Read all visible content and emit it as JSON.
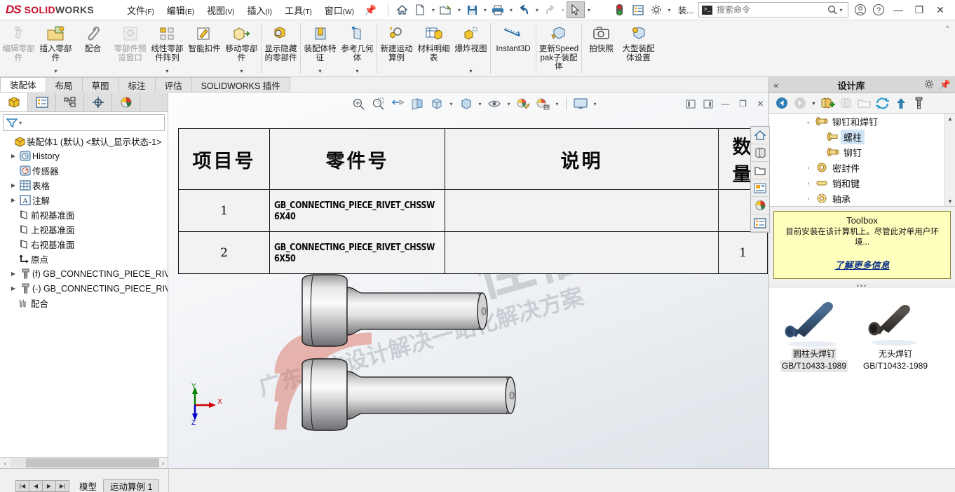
{
  "app": {
    "brand_ds": "DS",
    "brand_solid": "SOLID",
    "brand_works": "WORKS",
    "brand_color": "#c8102e"
  },
  "menubar": {
    "items": [
      {
        "label": "文件",
        "mnemonic": "(F)"
      },
      {
        "label": "编辑",
        "mnemonic": "(E)"
      },
      {
        "label": "视图",
        "mnemonic": "(V)"
      },
      {
        "label": "插入",
        "mnemonic": "(I)"
      },
      {
        "label": "工具",
        "mnemonic": "(T)"
      },
      {
        "label": "窗口",
        "mnemonic": "(W)"
      }
    ],
    "pin": "pin-icon"
  },
  "quick_access": {
    "buttons": [
      {
        "name": "home-button",
        "icon": "home-icon",
        "caret": false
      },
      {
        "name": "new-document-button",
        "icon": "new-file-icon",
        "caret": true
      },
      {
        "name": "open-document-button",
        "icon": "open-folder-icon",
        "caret": true
      },
      {
        "name": "save-button",
        "icon": "save-floppy-icon",
        "caret": true
      },
      {
        "name": "print-button",
        "icon": "printer-icon",
        "caret": true
      },
      {
        "name": "undo-button",
        "icon": "undo-arrow-icon",
        "caret": true
      },
      {
        "name": "redo-button",
        "icon": "redo-arrow-icon",
        "caret": true
      },
      {
        "name": "select-button",
        "icon": "cursor-arrow-icon",
        "caret": true
      }
    ]
  },
  "title_right": {
    "rebuild_icon": "traffic-light-icon",
    "display_icon": "display-pane-icon",
    "options_icon": "gear-icon",
    "config_label": "装...",
    "search_placeholder": "搜索命令",
    "search_value": "",
    "search_icon": "magnifier-icon",
    "command_icon": "command-prompt-icon",
    "account_icon": "user-account-icon",
    "help_icon": "question-help-icon",
    "minimize": "—",
    "restore": "❐",
    "close": "✕"
  },
  "ribbon": {
    "collapse_icon": "chevron-up-icon",
    "buttons": [
      {
        "label": "编辑零部件",
        "icon": "edit-component-icon",
        "dropdown": false,
        "disabled": true,
        "group": 0
      },
      {
        "label": "插入零部件",
        "icon": "insert-component-icon",
        "dropdown": true,
        "disabled": false,
        "group": 0
      },
      {
        "label": "配合",
        "icon": "mate-paperclip-icon",
        "dropdown": false,
        "disabled": false,
        "group": 0
      },
      {
        "label": "零部件预览窗口",
        "icon": "component-preview-icon",
        "dropdown": false,
        "disabled": true,
        "group": 0
      },
      {
        "label": "线性零部件阵列",
        "icon": "linear-component-pattern-icon",
        "dropdown": true,
        "disabled": false,
        "group": 0
      },
      {
        "label": "智能扣件",
        "icon": "smart-fastener-icon",
        "dropdown": false,
        "disabled": false,
        "group": 0
      },
      {
        "label": "移动零部件",
        "icon": "move-component-icon",
        "dropdown": true,
        "disabled": false,
        "group": 0
      },
      {
        "label": "显示隐藏的零部件",
        "icon": "show-hidden-components-icon",
        "dropdown": false,
        "disabled": false,
        "group": 1
      },
      {
        "label": "装配体特征",
        "icon": "assembly-feature-icon",
        "dropdown": true,
        "disabled": false,
        "group": 2
      },
      {
        "label": "参考几何体",
        "icon": "reference-geometry-icon",
        "dropdown": true,
        "disabled": false,
        "group": 2
      },
      {
        "label": "新建运动算例",
        "icon": "new-motion-study-icon",
        "dropdown": false,
        "disabled": false,
        "group": 3
      },
      {
        "label": "材料明细表",
        "icon": "bill-of-materials-icon",
        "dropdown": false,
        "disabled": false,
        "group": 3
      },
      {
        "label": "爆炸视图",
        "icon": "exploded-view-icon",
        "dropdown": true,
        "disabled": false,
        "group": 3
      },
      {
        "label": "Instant3D",
        "icon": "instant3d-icon",
        "dropdown": false,
        "disabled": false,
        "group": 4
      },
      {
        "label": "更新Speedpak子装配体",
        "icon": "update-speedpak-icon",
        "dropdown": false,
        "disabled": false,
        "group": 5
      },
      {
        "label": "拍快照",
        "icon": "camera-snapshot-icon",
        "dropdown": false,
        "disabled": false,
        "group": 6
      },
      {
        "label": "大型装配体设置",
        "icon": "large-assembly-settings-icon",
        "dropdown": false,
        "disabled": false,
        "group": 6
      }
    ]
  },
  "command_tabs": {
    "items": [
      "装配体",
      "布局",
      "草图",
      "标注",
      "评估",
      "SOLIDWORKS 插件"
    ],
    "active_index": 0
  },
  "feature_manager": {
    "tabs": [
      {
        "name": "feature-manager-tab",
        "icon": "assembly-tree-icon",
        "active": true
      },
      {
        "name": "property-manager-tab",
        "icon": "property-list-icon",
        "active": false
      },
      {
        "name": "configuration-manager-tab",
        "icon": "configuration-icon",
        "active": false
      },
      {
        "name": "dimxpert-manager-tab",
        "icon": "dimxpert-target-icon",
        "active": false
      },
      {
        "name": "display-manager-tab",
        "icon": "appearance-sphere-icon",
        "active": false
      }
    ],
    "filter_icon": "filter-funnel-icon",
    "root": "装配体1 (默认) <默认_显示状态-1>",
    "nodes": [
      {
        "label": "History",
        "icon": "history-clock-icon",
        "arrow": true,
        "indent": 1
      },
      {
        "label": "传感器",
        "icon": "sensor-icon",
        "arrow": false,
        "indent": 1
      },
      {
        "label": "表格",
        "icon": "tables-grid-icon",
        "arrow": true,
        "indent": 1
      },
      {
        "label": "注解",
        "icon": "annotations-a-icon",
        "arrow": true,
        "indent": 1
      },
      {
        "label": "前视基准面",
        "icon": "plane-icon",
        "arrow": false,
        "indent": 1
      },
      {
        "label": "上视基准面",
        "icon": "plane-icon",
        "arrow": false,
        "indent": 1
      },
      {
        "label": "右视基准面",
        "icon": "plane-icon",
        "arrow": false,
        "indent": 1
      },
      {
        "label": "原点",
        "icon": "origin-axes-icon",
        "arrow": false,
        "indent": 1
      },
      {
        "label": "(f) GB_CONNECTING_PIECE_RIVE",
        "icon": "component-bolt-icon",
        "arrow": true,
        "indent": 1
      },
      {
        "label": "(-) GB_CONNECTING_PIECE_RIVE",
        "icon": "component-bolt-icon",
        "arrow": true,
        "indent": 1
      },
      {
        "label": "配合",
        "icon": "mates-folder-icon",
        "arrow": false,
        "indent": 1
      }
    ],
    "hscroll_left": "‹",
    "hscroll_right": "›"
  },
  "view_toolbar": {
    "buttons": [
      {
        "name": "zoom-to-fit-button",
        "icon": "zoom-fit-icon",
        "caret": false
      },
      {
        "name": "zoom-to-area-button",
        "icon": "zoom-area-icon",
        "caret": false
      },
      {
        "name": "previous-view-button",
        "icon": "previous-view-icon",
        "caret": false
      },
      {
        "name": "section-view-button",
        "icon": "section-view-icon",
        "caret": false
      },
      {
        "name": "view-orientation-button",
        "icon": "view-orientation-cube-icon",
        "caret": true
      },
      {
        "name": "display-style-button",
        "icon": "display-style-box-icon",
        "caret": true
      },
      {
        "name": "hide-show-items-button",
        "icon": "hide-show-eye-icon",
        "caret": true
      },
      {
        "name": "edit-appearance-button",
        "icon": "edit-appearance-icon",
        "caret": false
      },
      {
        "name": "apply-scene-button",
        "icon": "apply-scene-icon",
        "caret": true
      },
      {
        "name": "view-settings-button",
        "icon": "view-settings-monitor-icon",
        "caret": true
      }
    ],
    "window_controls": [
      {
        "name": "restore-left-button",
        "icon": "pane-left-icon"
      },
      {
        "name": "restore-right-button",
        "icon": "pane-right-icon"
      },
      {
        "name": "minimize-doc-button",
        "icon": "minimize-icon"
      },
      {
        "name": "restore-doc-button",
        "icon": "restore-icon"
      },
      {
        "name": "close-doc-button",
        "icon": "close-icon"
      }
    ]
  },
  "bom_table": {
    "headers": [
      "项目号",
      "零件号",
      "说明",
      "数量"
    ],
    "rows": [
      {
        "item": "1",
        "part": "GB_CONNECTING_PIECE_RIVET_CHSSW 6X40",
        "desc": "",
        "qty": ""
      },
      {
        "item": "2",
        "part": "GB_CONNECTING_PIECE_RIVET_CHSSW 6X50",
        "desc": "",
        "qty": "1"
      }
    ]
  },
  "graphics": {
    "watermark_big": "佳信科技",
    "watermark_mid": "广东佳信设计解决一站化解决方案",
    "triad": {
      "x": "X",
      "y": "Y",
      "z": "Z",
      "x_color": "#cc0000",
      "y_color": "#008000",
      "z_color": "#0000cc"
    }
  },
  "task_pane": {
    "icons": [
      {
        "name": "sw-resources-icon",
        "glyph": "home"
      },
      {
        "name": "design-library-icon",
        "glyph": "library"
      },
      {
        "name": "file-explorer-icon",
        "glyph": "folder"
      },
      {
        "name": "view-palette-icon",
        "glyph": "palette"
      },
      {
        "name": "appearances-scenes-icon",
        "glyph": "sphere"
      },
      {
        "name": "custom-properties-icon",
        "glyph": "properties"
      }
    ]
  },
  "design_library": {
    "collapse_icon": "double-chevron-left-icon",
    "title": "设计库",
    "settings_icon": "gear-icon",
    "pin_icon": "pin-icon",
    "toolbar": [
      {
        "name": "back-button",
        "icon": "back-arrow-icon",
        "disabled": false
      },
      {
        "name": "forward-button",
        "icon": "forward-arrow-icon",
        "disabled": true
      },
      {
        "name": "history-dropdown-button",
        "icon": "chevron-down-icon",
        "disabled": false
      },
      {
        "name": "add-to-library-button",
        "icon": "add-library-icon",
        "disabled": false
      },
      {
        "name": "delete-library-button",
        "icon": "delete-library-icon",
        "disabled": true
      },
      {
        "name": "create-folder-button",
        "icon": "new-folder-icon",
        "disabled": true
      },
      {
        "name": "refresh-button",
        "icon": "refresh-icon",
        "disabled": false
      },
      {
        "name": "up-level-button",
        "icon": "up-arrow-icon",
        "disabled": false
      },
      {
        "name": "toolbox-button",
        "icon": "toolbox-bolt-icon",
        "disabled": false
      }
    ],
    "tree": [
      {
        "label": "铆钉和焊钉",
        "icon": "rivet-icon",
        "arrow": "expanded",
        "indent": 1,
        "selected": false
      },
      {
        "label": "螺柱",
        "icon": "stud-icon",
        "arrow": "none",
        "indent": 2,
        "selected": true
      },
      {
        "label": "铆钉",
        "icon": "rivet-icon",
        "arrow": "none",
        "indent": 2,
        "selected": false
      },
      {
        "label": "密封件",
        "icon": "seal-ring-icon",
        "arrow": "collapsed",
        "indent": 1,
        "selected": false
      },
      {
        "label": "销和键",
        "icon": "pin-key-icon",
        "arrow": "collapsed",
        "indent": 1,
        "selected": false
      },
      {
        "label": "轴承",
        "icon": "bearing-icon",
        "arrow": "collapsed",
        "indent": 1,
        "selected": false
      }
    ],
    "toolbox_note": {
      "title": "Toolbox",
      "body": "目前安装在该计算机上。尽管此对单用户环境...",
      "link": "了解更多信息",
      "bg_color": "#ffffbe"
    },
    "items": [
      {
        "name_line1": "圆柱头焊钉",
        "name_line2": "GB/T10433-1989",
        "color": "#33506e",
        "kind": "cylinder-head-weld-stud",
        "selected": true
      },
      {
        "name_line1": "无头焊钉",
        "name_line2": "GB/T10432-1989",
        "color": "#3d3a36",
        "kind": "headless-weld-stud",
        "selected": false
      }
    ]
  },
  "bottom_bar": {
    "nav_buttons": [
      "|◀",
      "◀",
      "▶",
      "▶|"
    ],
    "tabs": [
      {
        "label": "模型",
        "active": true
      },
      {
        "label": "运动算例 1",
        "active": false
      }
    ]
  }
}
